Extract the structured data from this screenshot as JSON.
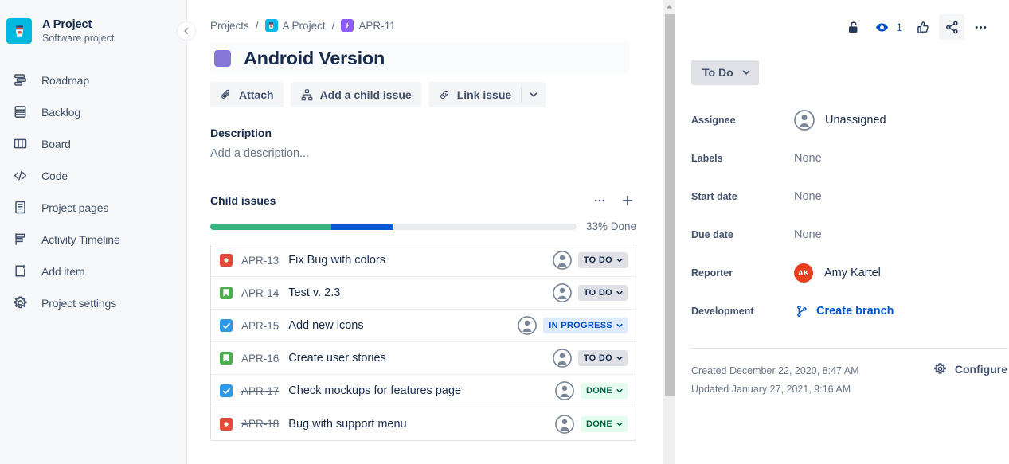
{
  "sidebar": {
    "project": {
      "name": "A Project",
      "subtitle": "Software project",
      "avatar_icon": "coffee-cup-icon",
      "avatar_color": "#00b8e0"
    },
    "collapse_icon": "chevron-left-icon",
    "items": [
      {
        "label": "Roadmap",
        "icon": "roadmap-icon"
      },
      {
        "label": "Backlog",
        "icon": "backlog-icon"
      },
      {
        "label": "Board",
        "icon": "board-icon"
      },
      {
        "label": "Code",
        "icon": "code-icon"
      },
      {
        "label": "Project pages",
        "icon": "pages-icon"
      },
      {
        "label": "Activity Timeline",
        "icon": "activity-timeline-icon"
      },
      {
        "label": "Add item",
        "icon": "add-item-icon"
      },
      {
        "label": "Project settings",
        "icon": "gear-icon"
      }
    ]
  },
  "breadcrumb": {
    "projects": "Projects",
    "project": "A Project",
    "issue_key": "APR-11",
    "sep": "/",
    "project_icon": "project-avatar-icon",
    "epic_icon": "epic-lightning-icon"
  },
  "issue": {
    "title": "Android Version",
    "title_square_color": "#8777d9"
  },
  "actions": {
    "attach": {
      "label": "Attach",
      "icon": "paperclip-icon"
    },
    "add_child": {
      "label": "Add a child issue",
      "icon": "child-issue-icon"
    },
    "link_issue": {
      "label": "Link issue",
      "icon": "link-icon"
    },
    "more_caret_icon": "chevron-down-icon"
  },
  "description": {
    "heading": "Description",
    "placeholder": "Add a description..."
  },
  "child_issues": {
    "heading": "Child issues",
    "more_icon": "ellipsis-icon",
    "add_icon": "plus-icon",
    "progress": {
      "label": "33% Done",
      "done_percent": 33,
      "in_progress_percent": 17,
      "done_color": "#36b37e",
      "in_progress_color": "#0b58d6",
      "track_color": "#ebecf0"
    },
    "rows": [
      {
        "type": "bug",
        "type_icon": "bug-icon",
        "key": "APR-13",
        "key_struck": false,
        "summary": "Fix Bug with colors",
        "status": "TO DO",
        "status_class": "todo",
        "assignee_icon": "unassigned-avatar-icon"
      },
      {
        "type": "story",
        "type_icon": "story-icon",
        "key": "APR-14",
        "key_struck": false,
        "summary": "Test v. 2.3",
        "status": "TO DO",
        "status_class": "todo",
        "assignee_icon": "unassigned-avatar-icon"
      },
      {
        "type": "task",
        "type_icon": "task-icon",
        "key": "APR-15",
        "key_struck": false,
        "summary": "Add new icons",
        "status": "IN PROGRESS",
        "status_class": "inprogress",
        "assignee_icon": "unassigned-avatar-icon"
      },
      {
        "type": "story",
        "type_icon": "story-icon",
        "key": "APR-16",
        "key_struck": false,
        "summary": "Create user stories",
        "status": "TO DO",
        "status_class": "todo",
        "assignee_icon": "unassigned-avatar-icon"
      },
      {
        "type": "task",
        "type_icon": "task-icon",
        "key": "APR-17",
        "key_struck": true,
        "summary": "Check mockups for features page",
        "status": "DONE",
        "status_class": "done",
        "assignee_icon": "unassigned-avatar-icon"
      },
      {
        "type": "bug",
        "type_icon": "bug-icon",
        "key": "APR-18",
        "key_struck": true,
        "summary": "Bug with support menu",
        "status": "DONE",
        "status_class": "done",
        "assignee_icon": "unassigned-avatar-icon"
      }
    ]
  },
  "right_panel": {
    "toolbar": {
      "lock_icon": "unlock-icon",
      "watch_icon": "eye-icon",
      "watch_count": "1",
      "like_icon": "thumbs-up-icon",
      "share_icon": "share-icon",
      "more_icon": "ellipsis-icon"
    },
    "status": {
      "label": "To Do",
      "caret_icon": "chevron-down-icon"
    },
    "fields": [
      {
        "label": "Assignee",
        "value": "Unassigned",
        "kind": "avatar",
        "icon": "unassigned-avatar-icon"
      },
      {
        "label": "Labels",
        "value": "None",
        "kind": "none"
      },
      {
        "label": "Start date",
        "value": "None",
        "kind": "none"
      },
      {
        "label": "Due date",
        "value": "None",
        "kind": "none"
      },
      {
        "label": "Reporter",
        "value": "Amy Kartel",
        "kind": "person",
        "initials": "AK",
        "avatar_color": "#e8401f"
      },
      {
        "label": "Development",
        "value": "Create branch",
        "kind": "link",
        "icon": "branch-icon"
      }
    ],
    "footer": {
      "created": "Created December 22, 2020, 8:47 AM",
      "updated": "Updated January 27, 2021, 9:16 AM",
      "configure_label": "Configure",
      "configure_icon": "gear-icon"
    }
  },
  "scrollbar": {
    "up_arrow_icon": "caret-up-icon"
  }
}
